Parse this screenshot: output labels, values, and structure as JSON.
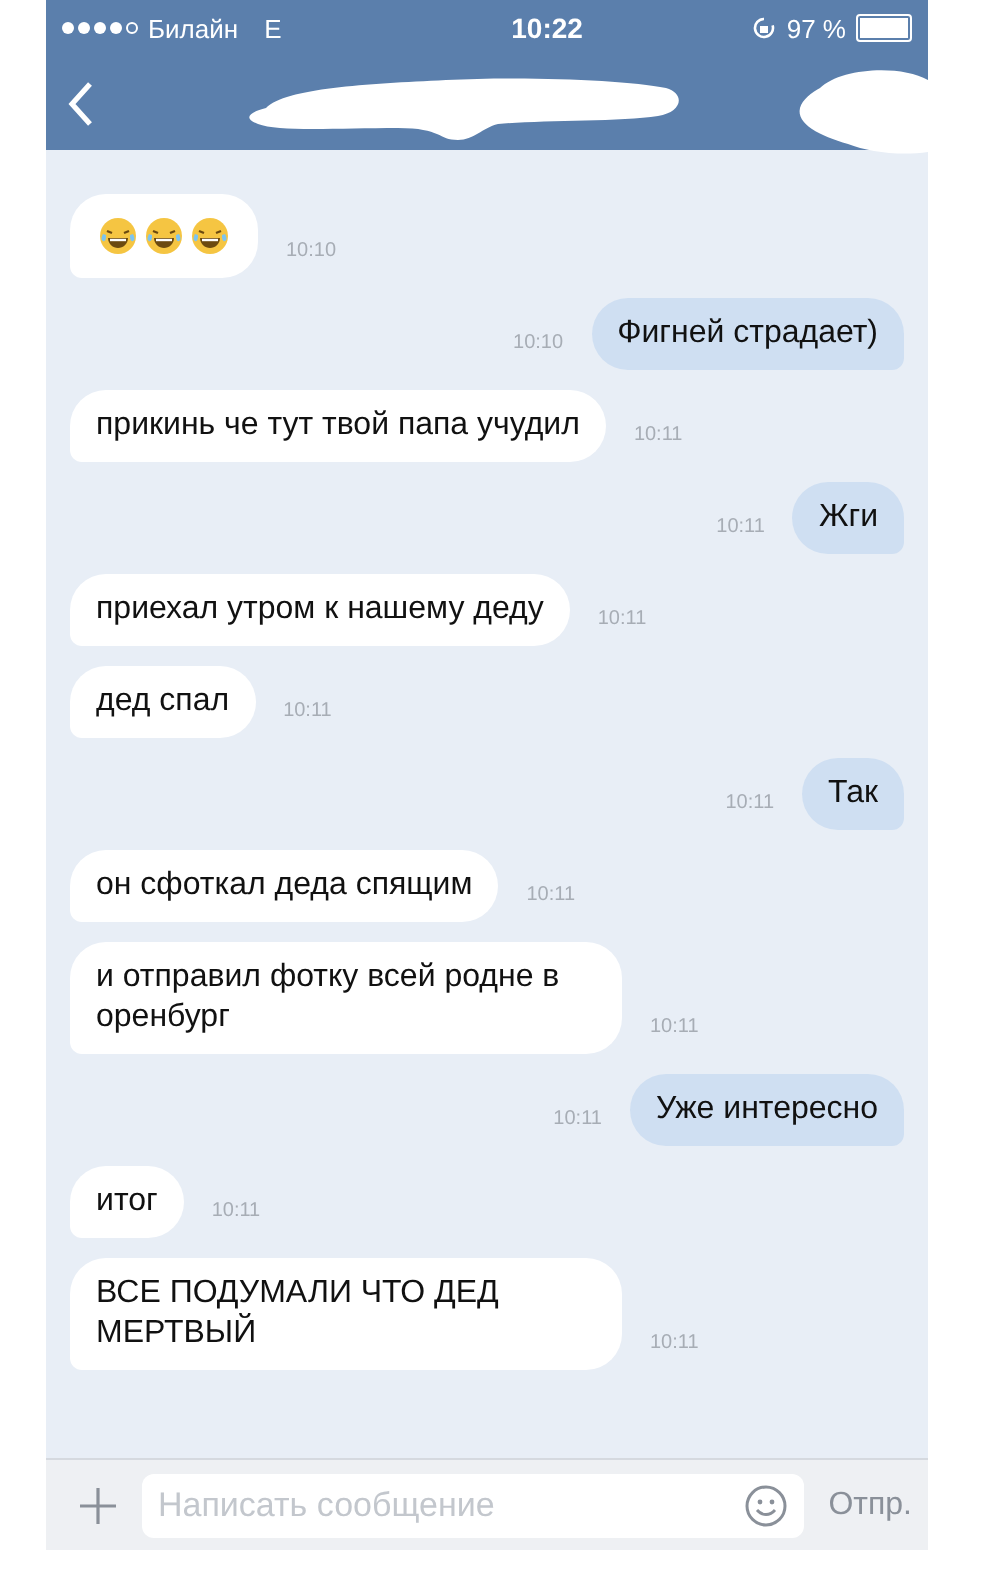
{
  "status_bar": {
    "carrier": "Билайн",
    "network": "E",
    "time": "10:22",
    "battery": "97 %"
  },
  "messages": [
    {
      "kind": "emoji",
      "outgoing": false,
      "time": "10:10"
    },
    {
      "kind": "text",
      "outgoing": true,
      "text": "Фигней страдает)",
      "time": "10:10"
    },
    {
      "kind": "text",
      "outgoing": false,
      "text": "прикинь че тут твой папа учудил",
      "time": "10:11"
    },
    {
      "kind": "text",
      "outgoing": true,
      "text": "Жги",
      "time": "10:11"
    },
    {
      "kind": "text",
      "outgoing": false,
      "text": "приехал утром к нашему деду",
      "time": "10:11"
    },
    {
      "kind": "text",
      "outgoing": false,
      "text": "дед спал",
      "time": "10:11"
    },
    {
      "kind": "text",
      "outgoing": true,
      "text": "Так",
      "time": "10:11"
    },
    {
      "kind": "text",
      "outgoing": false,
      "text": "он сфоткал деда спящим",
      "time": "10:11"
    },
    {
      "kind": "text",
      "outgoing": false,
      "text": "и отправил фотку всей родне в оренбург",
      "time": "10:11"
    },
    {
      "kind": "text",
      "outgoing": true,
      "text": "Уже интересно",
      "time": "10:11"
    },
    {
      "kind": "text",
      "outgoing": false,
      "text": "итог",
      "time": "10:11"
    },
    {
      "kind": "text",
      "outgoing": false,
      "text": "ВСЕ ПОДУМАЛИ ЧТО ДЕД МЕРТВЫЙ",
      "time": "10:11"
    }
  ],
  "composer": {
    "placeholder": "Написать сообщение",
    "send": "Отпр."
  }
}
